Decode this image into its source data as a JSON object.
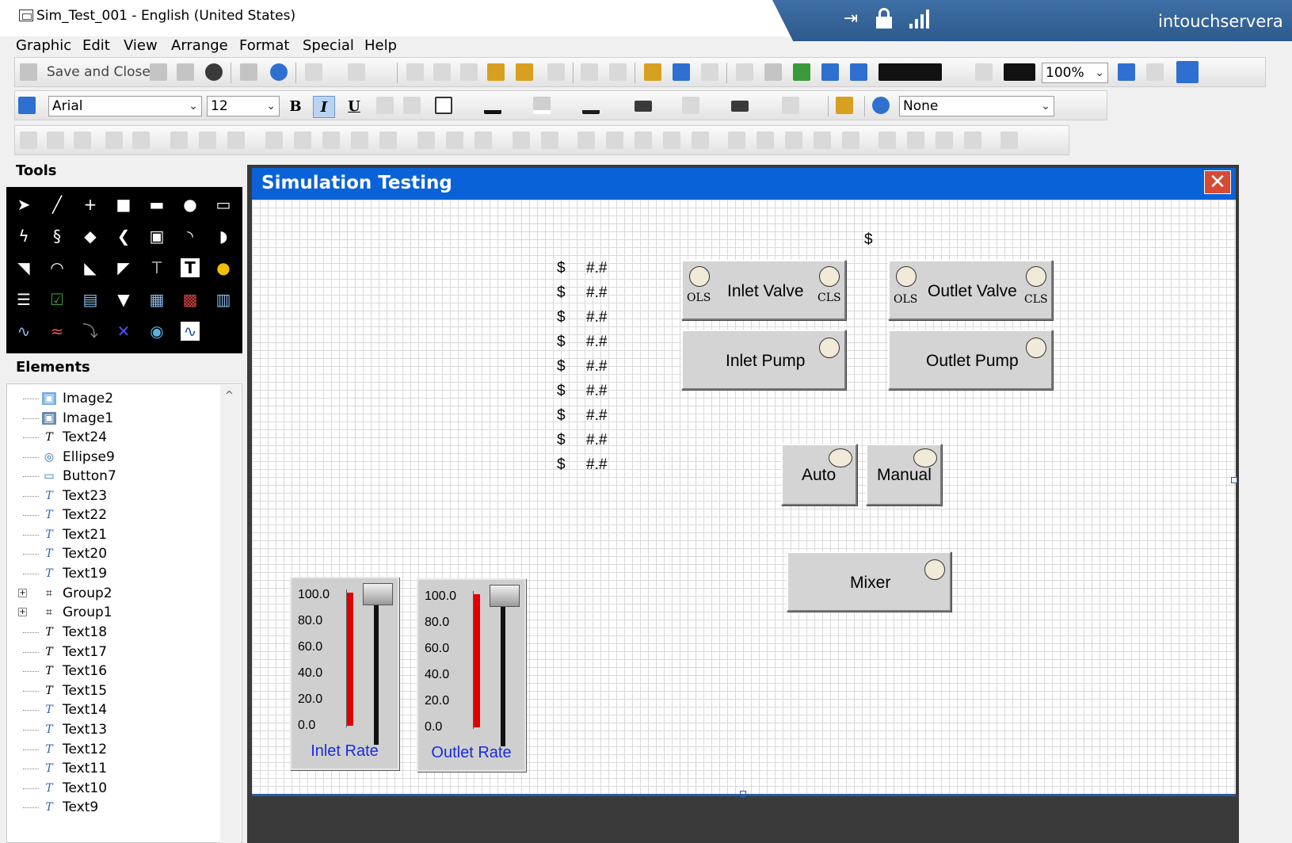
{
  "window": {
    "title": "Sim_Test_001 - English (United States)"
  },
  "remote_bar": {
    "host": "intouchservera"
  },
  "menu": [
    "Graphic",
    "Edit",
    "View",
    "Arrange",
    "Format",
    "Special",
    "Help"
  ],
  "toolbar": {
    "save_close_label": "Save and Close",
    "zoom_value": "100%",
    "font_name": "Arial",
    "font_size": "12",
    "bold": "B",
    "italic": "I",
    "underline": "U",
    "style_value": "None"
  },
  "panels": {
    "tools_title": "Tools",
    "elements_title": "Elements",
    "elements": [
      {
        "name": "Image2",
        "icon": "image-group-icon"
      },
      {
        "name": "Image1",
        "icon": "image-icon"
      },
      {
        "name": "Text24",
        "icon": "text-icon"
      },
      {
        "name": "Ellipse9",
        "icon": "ellipse-group-icon"
      },
      {
        "name": "Button7",
        "icon": "button-group-icon"
      },
      {
        "name": "Text23",
        "icon": "text-animated-icon"
      },
      {
        "name": "Text22",
        "icon": "text-animated-icon"
      },
      {
        "name": "Text21",
        "icon": "text-animated-icon"
      },
      {
        "name": "Text20",
        "icon": "text-animated-icon"
      },
      {
        "name": "Text19",
        "icon": "text-animated-icon"
      },
      {
        "name": "Group2",
        "icon": "group-icon",
        "expandable": true
      },
      {
        "name": "Group1",
        "icon": "group-icon",
        "expandable": true
      },
      {
        "name": "Text18",
        "icon": "text-icon"
      },
      {
        "name": "Text17",
        "icon": "text-icon"
      },
      {
        "name": "Text16",
        "icon": "text-icon"
      },
      {
        "name": "Text15",
        "icon": "text-icon"
      },
      {
        "name": "Text14",
        "icon": "text-animated-icon"
      },
      {
        "name": "Text13",
        "icon": "text-animated-icon"
      },
      {
        "name": "Text12",
        "icon": "text-animated-icon"
      },
      {
        "name": "Text11",
        "icon": "text-animated-icon"
      },
      {
        "name": "Text10",
        "icon": "text-animated-icon"
      },
      {
        "name": "Text9",
        "icon": "text-animated-icon"
      }
    ]
  },
  "canvas": {
    "title": "Simulation Testing",
    "close_glyph": "✕",
    "dollar_label": "$",
    "value_placeholder": "#.#",
    "value_rows": 9,
    "top_dollar": "$",
    "inlet_valve": {
      "label": "Inlet Valve",
      "ols": "OLS",
      "cls": "CLS"
    },
    "outlet_valve": {
      "label": "Outlet Valve",
      "ols": "OLS",
      "cls": "CLS"
    },
    "inlet_pump": {
      "label": "Inlet Pump"
    },
    "outlet_pump": {
      "label": "Outlet Pump"
    },
    "auto": {
      "label": "Auto"
    },
    "manual": {
      "label": "Manual"
    },
    "mixer": {
      "label": "Mixer"
    },
    "inlet_rate": {
      "caption": "Inlet Rate",
      "ticks": [
        "100.0",
        "80.0",
        "60.0",
        "40.0",
        "20.0",
        "0.0"
      ],
      "fill_percent": 100,
      "thumb_percent": 100
    },
    "outlet_rate": {
      "caption": "Outlet Rate",
      "ticks": [
        "100.0",
        "80.0",
        "60.0",
        "40.0",
        "20.0",
        "0.0"
      ],
      "fill_percent": 100,
      "thumb_percent": 100
    }
  },
  "colors": {
    "accent": "#0a62d8",
    "fill": "#e00000",
    "caption": "#1a2bd8",
    "lamp": "#f2ead8"
  }
}
